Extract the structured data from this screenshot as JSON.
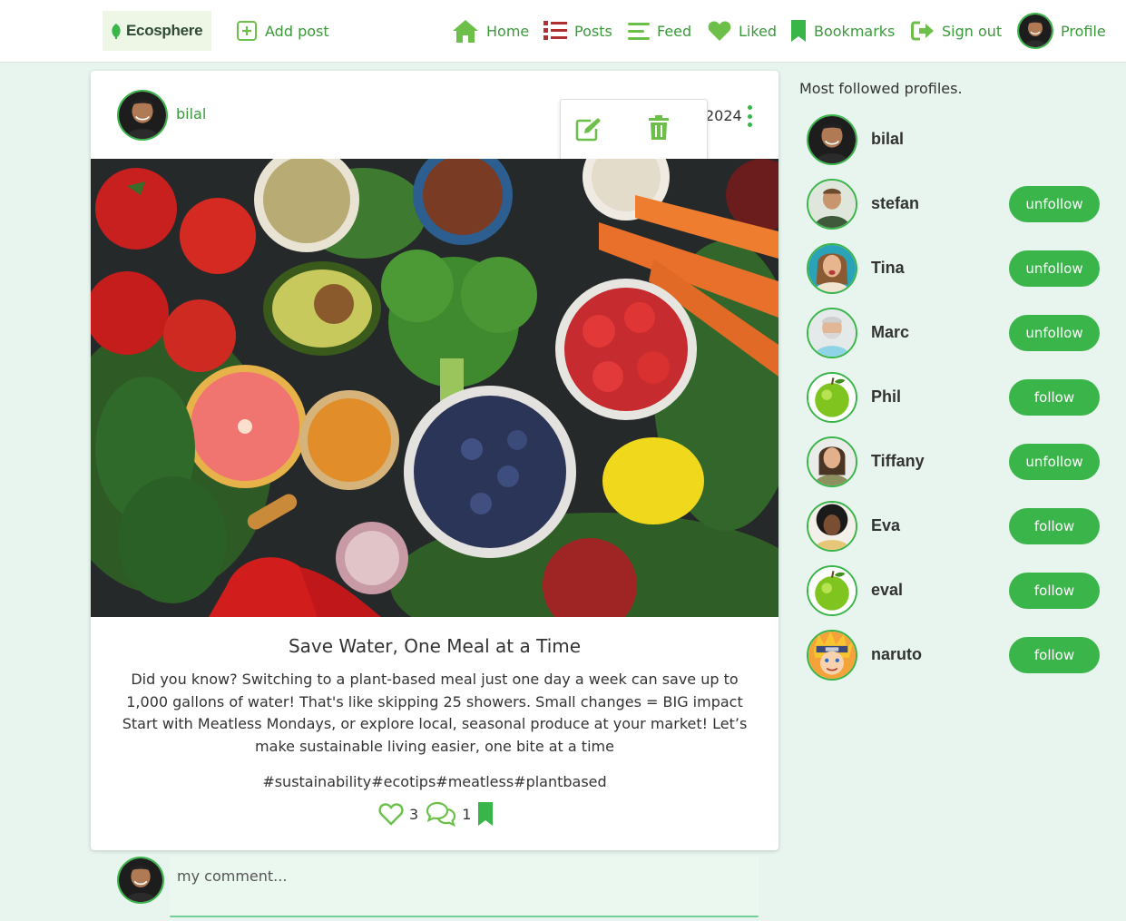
{
  "nav": {
    "logo_text": "Ecosphere",
    "add_post": "Add post",
    "home": "Home",
    "posts": "Posts",
    "feed": "Feed",
    "liked": "Liked",
    "bookmarks": "Bookmarks",
    "sign_out": "Sign out",
    "profile": "Profile"
  },
  "post": {
    "author": "bilal",
    "date": "2024",
    "title": "Save Water, One Meal at a Time",
    "body": "Did you know? Switching to a plant-based meal just one day a week can save up to 1,000 gallons of water! That's like skipping 25 showers. Small changes = BIG impact Start with Meatless Mondays, or explore local, seasonal produce at your market! Let’s make sustainable living easier, one bite at a time",
    "tags": "#sustainability#ecotips#meatless#plantbased",
    "likes": "3",
    "comments": "1"
  },
  "comment": {
    "placeholder": "my comment..."
  },
  "sidebar": {
    "title": "Most followed profiles.",
    "profiles": [
      {
        "name": "bilal",
        "button": ""
      },
      {
        "name": "stefan",
        "button": "unfollow"
      },
      {
        "name": "Tina",
        "button": "unfollow"
      },
      {
        "name": "Marc",
        "button": "unfollow"
      },
      {
        "name": "Phil",
        "button": "follow"
      },
      {
        "name": "Tiffany",
        "button": "unfollow"
      },
      {
        "name": "Eva",
        "button": "follow"
      },
      {
        "name": "eval",
        "button": "follow"
      },
      {
        "name": "naruto",
        "button": "follow"
      }
    ]
  },
  "colors": {
    "accent": "#3ab54a",
    "background": "#e8f5ee",
    "link": "#3a9a3a"
  }
}
